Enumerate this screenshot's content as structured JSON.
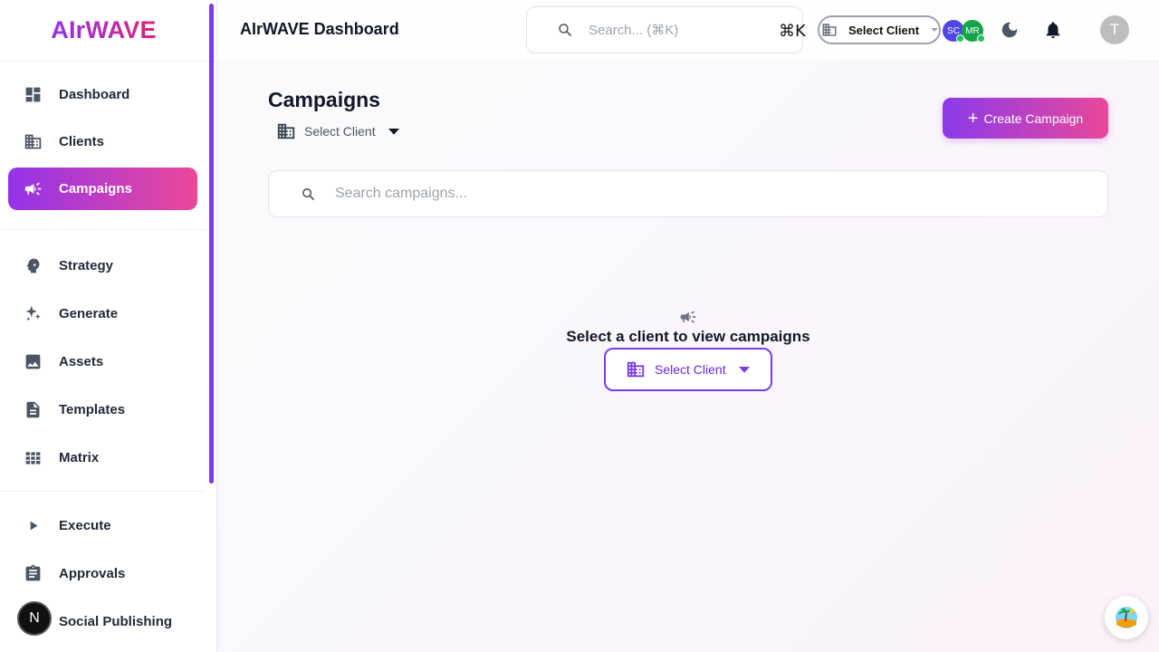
{
  "app": {
    "brand": "AIrWAVE",
    "header_title": "AIrWAVE Dashboard"
  },
  "sidebar": {
    "group_1": [
      {
        "label": "Dashboard",
        "icon": "dashboard-icon",
        "active": false
      },
      {
        "label": "Clients",
        "icon": "building-icon",
        "active": false
      },
      {
        "label": "Campaigns",
        "icon": "megaphone-icon",
        "active": true
      }
    ],
    "group_2": [
      {
        "label": "Strategy",
        "icon": "psychology-icon",
        "active": false
      },
      {
        "label": "Generate",
        "icon": "sparkle-icon",
        "active": false
      },
      {
        "label": "Assets",
        "icon": "image-icon",
        "active": false
      },
      {
        "label": "Templates",
        "icon": "document-icon",
        "active": false
      },
      {
        "label": "Matrix",
        "icon": "grid-icon",
        "active": false
      }
    ],
    "group_3": [
      {
        "label": "Execute",
        "icon": "play-icon",
        "active": false
      },
      {
        "label": "Approvals",
        "icon": "clipboard-icon",
        "active": false
      },
      {
        "label": "Social Publishing",
        "icon": "share-icon",
        "active": false
      }
    ],
    "floating_badge": "N"
  },
  "topbar": {
    "search_placeholder": "Search... (⌘K)",
    "shortcut": "⌘K",
    "client_select": "Select Client",
    "avatars": [
      {
        "initials": "SC",
        "color": "#4f46e5"
      },
      {
        "initials": "MR",
        "color": "#16a34a"
      }
    ],
    "user_initial": "T"
  },
  "main": {
    "title": "Campaigns",
    "client_select": "Select Client",
    "create_button": "Create Campaign",
    "search_placeholder": "Search campaigns...",
    "empty_message": "Select a client to view campaigns",
    "empty_select": "Select Client"
  },
  "colors": {
    "accent_start": "#9333ea",
    "accent_end": "#ec4899",
    "border_purple": "#7c3aed"
  }
}
